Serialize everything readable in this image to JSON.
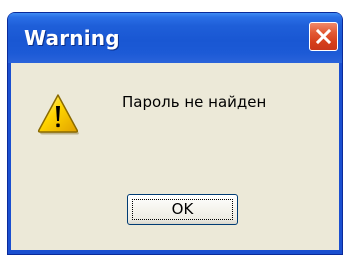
{
  "dialog": {
    "title": "Warning",
    "icon": "warning-icon",
    "message": "Пароль не найден",
    "ok_label": "OK",
    "close_icon": "close-icon"
  },
  "colors": {
    "titlebar": "#1957d3",
    "frame": "#1a4fd0",
    "client_background": "#ece9d8",
    "close_button": "#d63f1b",
    "warning_yellow": "#ffd700"
  }
}
